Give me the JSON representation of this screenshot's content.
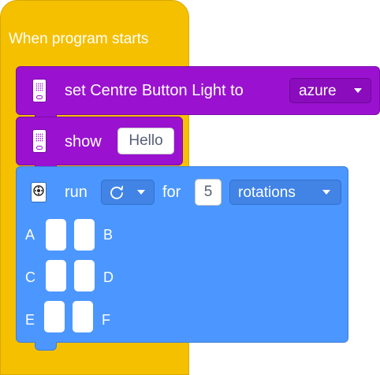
{
  "hat_block": {
    "title": "When program starts"
  },
  "light_block": {
    "label": "set Centre Button Light to",
    "color_value": "azure"
  },
  "show_block": {
    "label": "show",
    "text_value": "Hello"
  },
  "motor_block": {
    "run_label": "run",
    "direction_icon": "clockwise-icon",
    "for_label": "for",
    "amount_value": "5",
    "unit_value": "rotations",
    "ports": [
      {
        "left": "A",
        "right": "B"
      },
      {
        "left": "C",
        "right": "D"
      },
      {
        "left": "E",
        "right": "F"
      }
    ]
  },
  "colors": {
    "events_yellow": "#f5c000",
    "light_purple": "#9a12d0",
    "motor_blue": "#4c97ff"
  }
}
